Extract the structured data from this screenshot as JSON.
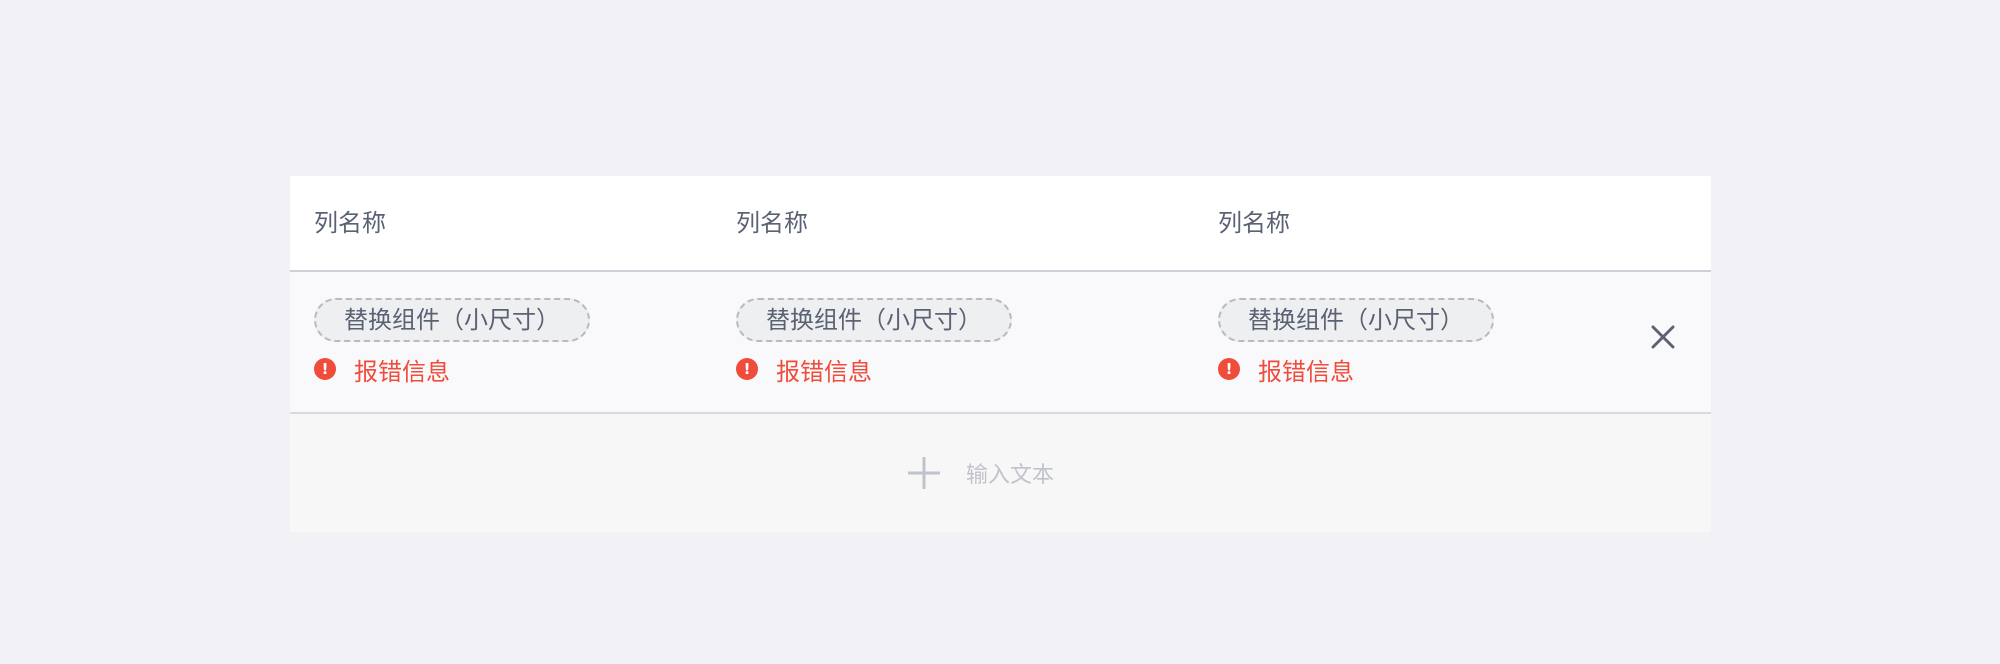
{
  "table": {
    "columns": [
      {
        "label": "列名称"
      },
      {
        "label": "列名称"
      },
      {
        "label": "列名称"
      }
    ],
    "rows": [
      {
        "cells": [
          {
            "chip": "替换组件（小尺寸）",
            "error": "报错信息"
          },
          {
            "chip": "替换组件（小尺寸）",
            "error": "报错信息"
          },
          {
            "chip": "替换组件（小尺寸）",
            "error": "报错信息"
          }
        ],
        "remove_icon": "close-icon"
      }
    ],
    "add_row": {
      "label": "输入文本",
      "icon": "plus-icon"
    }
  },
  "colors": {
    "page_background": "#f2f2f6",
    "header_text": "#5a6274",
    "error": "#ef4c3c",
    "chip_border": "#b8bac2",
    "chip_background": "#eeeff1",
    "placeholder": "#c0c3cb"
  }
}
